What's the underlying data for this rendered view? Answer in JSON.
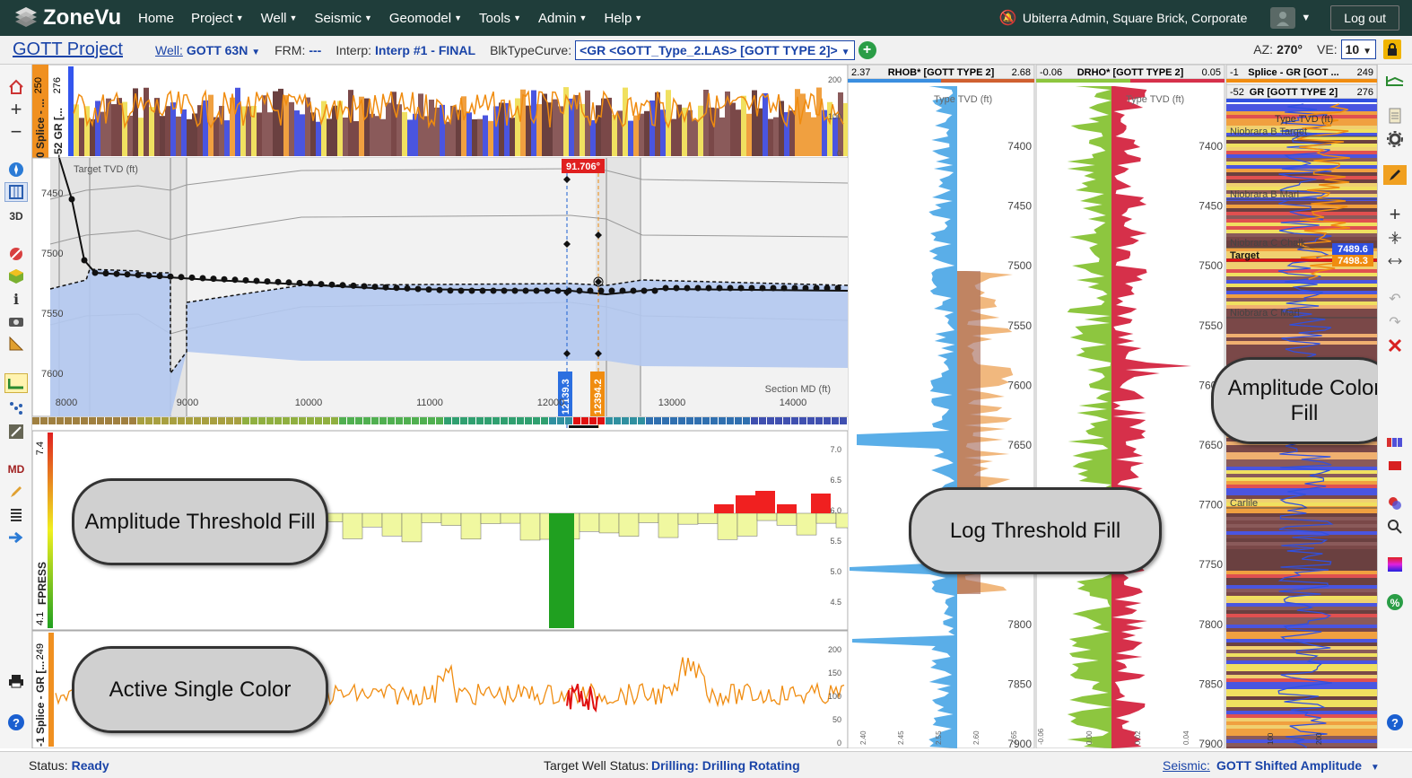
{
  "nav": {
    "logo": "ZoneVu",
    "menu": [
      {
        "label": "Home",
        "dropdown": false
      },
      {
        "label": "Project",
        "dropdown": true
      },
      {
        "label": "Well",
        "dropdown": true
      },
      {
        "label": "Seismic",
        "dropdown": true
      },
      {
        "label": "Geomodel",
        "dropdown": true
      },
      {
        "label": "Tools",
        "dropdown": true
      },
      {
        "label": "Admin",
        "dropdown": true
      },
      {
        "label": "Help",
        "dropdown": true
      }
    ],
    "user": "Ubiterra Admin, Square Brick, Corporate",
    "logout": "Log out"
  },
  "projectbar": {
    "project": "GOTT Project",
    "well_label": "Well:",
    "well_value": "GOTT 63N",
    "frm_label": "FRM:",
    "frm_value": "---",
    "interp_label": "Interp:",
    "interp_value": "Interp #1 - FINAL",
    "blk_label": "BlkTypeCurve:",
    "blk_value": "<GR <GOTT_Type_2.LAS> [GOTT TYPE 2]>",
    "az_label": "AZ:",
    "az_value": "270°",
    "ve_label": "VE:",
    "ve_value": "10"
  },
  "section": {
    "top_track_label_a": "0 Splice - ...",
    "top_track_label_b": "-52 GR [...",
    "top_track_top": "250",
    "top_track_top2": "276",
    "top_ticks": [
      "200",
      "100",
      "0"
    ],
    "target_tvd": "Target TVD (ft)",
    "section_md": "Section MD (ft)",
    "tvd_ticks": [
      "7450",
      "7500",
      "7550",
      "7600"
    ],
    "md_ticks": [
      "8000",
      "9000",
      "10000",
      "11000",
      "12000",
      "13000",
      "14000"
    ],
    "angle_badge": "91.706°",
    "cursor_a": "12139.3",
    "cursor_b": "12394.2",
    "fpress_label": "FPRESS",
    "fpress_top": "7.4",
    "fpress_bottom": "4.1",
    "fpress_ticks": [
      "7.0",
      "6.5",
      "6.0",
      "5.5",
      "5.0",
      "4.5"
    ],
    "gr_label": "-1 Splice - GR [...",
    "gr_top": "249",
    "gr_ticks": [
      "200",
      "150",
      "100",
      "50",
      "0"
    ]
  },
  "tracks": {
    "rhob": {
      "min": "2.37",
      "name": "RHOB* [GOTT TYPE 2]",
      "max": "2.68",
      "bottom_ticks": [
        "2.40",
        "2.45",
        "2.55",
        "2.60",
        "2.65"
      ]
    },
    "drho": {
      "min": "-0.06",
      "name": "DRHO* [GOTT TYPE 2]",
      "max": "0.05",
      "bottom_ticks": [
        "-0.06",
        "0.00",
        "0.02",
        "0.04"
      ]
    },
    "gr1": {
      "min": "-1",
      "name": "Splice - GR [GOT ...",
      "max": "249"
    },
    "gr2": {
      "min": "-52",
      "name": "GR [GOTT TYPE 2]",
      "max": "276"
    },
    "type_tvd": "Type TVD (ft)",
    "depth_ticks": [
      "7400",
      "7450",
      "7500",
      "7550",
      "7600",
      "7650",
      "7700",
      "7750",
      "7800",
      "7850",
      "7900"
    ],
    "tops": [
      "Niobrara B Target",
      "Niobrara B Marl",
      "Niobrara C Chalk",
      "Target",
      "Niobrara C Marl",
      "Carlile"
    ],
    "badge_blue": "7489.6",
    "badge_orange": "7498.3",
    "gr_bottom_ticks": [
      "100",
      "200"
    ]
  },
  "bubbles": {
    "amplitude_threshold": "Amplitude Threshold Fill",
    "active_single": "Active Single Color",
    "log_threshold": "Log Threshold Fill",
    "amplitude_color": "Amplitude Color Fill"
  },
  "status": {
    "label": "Status:",
    "value": "Ready",
    "target_label": "Target Well Status:",
    "target_value": "Drilling: Drilling Rotating",
    "seismic_label": "Seismic:",
    "seismic_value": "GOTT Shifted Amplitude"
  },
  "colors": {
    "nav_bg": "#1f3d3a",
    "link": "#1a44a8",
    "rhob_fill": "#5aaee8",
    "drho_fill": "#8dc63f",
    "drho_neg": "#d6304a",
    "gr_line": "#f08c10",
    "section_fill": "#b3c8f0"
  }
}
